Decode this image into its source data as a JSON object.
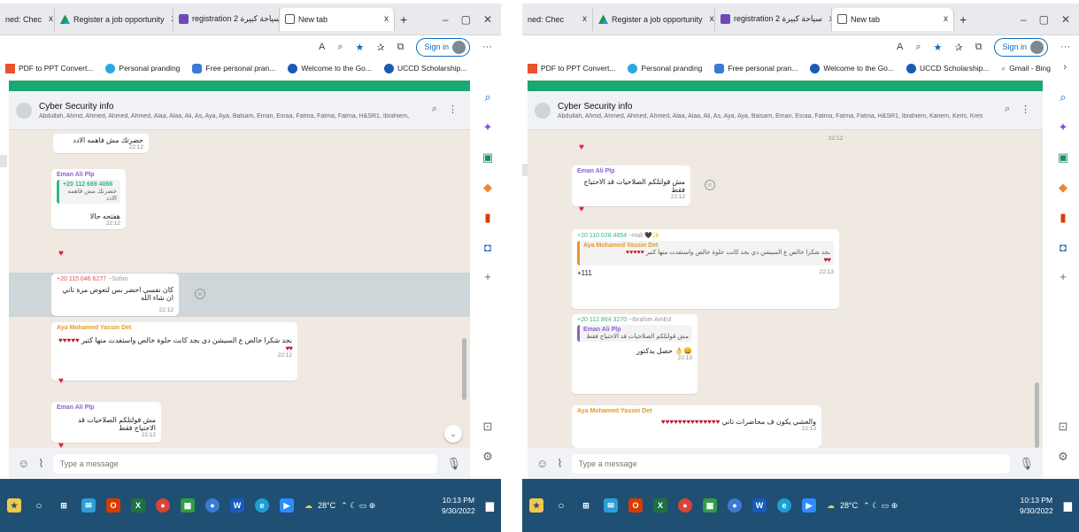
{
  "browser": {
    "tabs": [
      {
        "label": "ned: Chec"
      },
      {
        "label": "Register a job opportunity"
      },
      {
        "label": "registration 2 سياحة كبيرة"
      },
      {
        "label": "New tab"
      }
    ],
    "tab_close": "x",
    "new_tab": "+",
    "sign_in": "Sign in",
    "bookmarks": [
      "PDF to PPT Convert...",
      "Personal pranding",
      "Free personal pran...",
      "Welcome to the Go...",
      "UCCD Scholarship...",
      "Gmail - Bing"
    ]
  },
  "chat": {
    "title": "Cyber Security info",
    "members": "Abdullah, Ahmd, Ahmed, Ahmed, Ahmed, Alaa, Alaa, Ali, As, Aya, Aya, Balsam, Eman, Esraa, Fatma, Fatma, Fatma, H&SR1, Ibrahiem, Kariem, Kerls, Kres...",
    "composer_placeholder": "Type a message"
  },
  "left_messages": {
    "m0": {
      "text": "حضرتك مش فاهمه الادد",
      "time": "22:12"
    },
    "m1": {
      "sender": "Eman Ali Plp",
      "quote_sender": "+20 112 669 4066",
      "quote_text": "حضرتك مش فاهمه الادد",
      "text": "هفتحه حالا",
      "time": "22:12"
    },
    "m2": {
      "sender": "+20 115 046 6277",
      "sender_name": "~Sofan",
      "text": "كان نفسي احضر بس لتعوض مرة تاني ان شاء الله",
      "time": "22:12"
    },
    "m3": {
      "sender": "Aya Mohamed Yassin Det",
      "text": "بجد شكرا خالص ع السيشن دي بجد كانت حلوة خالص واستفدت منها كتير",
      "hearts": "♥♥♥♥♥",
      "hearts2": "♥♥",
      "time": "22:12"
    },
    "m4": {
      "sender": "Eman Ali Plp",
      "text": "مش قولتلكم الصلاحيات قد الاحتياج فقط",
      "time": "22:12"
    }
  },
  "right_messages": {
    "m0": {
      "time": "22:12"
    },
    "m1": {
      "sender": "Eman Ali Plp",
      "text": "مش قولتلكم الصلاحيات قد الاحتياج فقط",
      "time": "22:12"
    },
    "m2": {
      "sender": "+20 110 028 4654",
      "sender_name": "~Hali",
      "quote_sender": "Aya Mohamed Yassin Det",
      "quote_text": "بجد شكرا خالص ع السيشن دي بجد كانت حلوة خالص واستفدت منها كتير",
      "hearts": "♥♥♥♥♥",
      "hearts2": "♥♥",
      "text": "+111",
      "time": "22:13"
    },
    "m3": {
      "sender": "+20 112 864 3270",
      "sender_name": "~Ibrahim AmEd",
      "quote_sender": "Eman Ali Plp",
      "quote_text": "مش قولتلكم الصلاحيات قد الاحتياج فقط",
      "text": "حصل يدكتور",
      "time": "22:13"
    },
    "m4": {
      "sender": "Aya Mohamed Yassin Det",
      "text": "والعشي يكون ف محاضرات تاني",
      "hearts": "♥♥♥♥♥♥♥♥♥♥♥♥♥♥",
      "time": "22:13"
    }
  },
  "taskbar": {
    "weather": "28°C",
    "time": "10:13 PM",
    "date": "9/30/2022"
  },
  "colors": {
    "whatsapp_green": "#1ca672",
    "taskbar": "#1f4f73",
    "sender_green": "#35b883",
    "sender_purple": "#8a62c9",
    "sender_orange": "#e29a2a"
  }
}
